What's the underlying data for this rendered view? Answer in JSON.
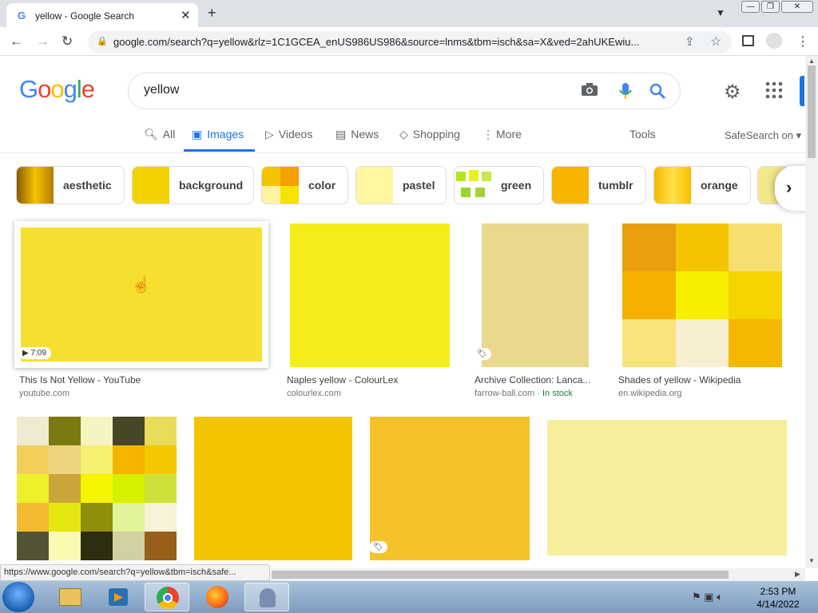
{
  "browser": {
    "tab_title": "yellow - Google Search",
    "tab_favicon": "G",
    "url": "google.com/search?q=yellow&rlz=1C1GCEA_enUS986US986&source=lnms&tbm=isch&sa=X&ved=2ahUKEwiu..."
  },
  "search": {
    "query": "yellow"
  },
  "tabs": [
    {
      "label": "All",
      "icon": "search-icon"
    },
    {
      "label": "Images",
      "icon": "image-icon",
      "active": true
    },
    {
      "label": "Videos",
      "icon": "video-icon"
    },
    {
      "label": "News",
      "icon": "news-icon"
    },
    {
      "label": "Shopping",
      "icon": "tag-icon"
    },
    {
      "label": "More",
      "icon": "more-vert-icon"
    }
  ],
  "tools_label": "Tools",
  "safesearch_label": "SafeSearch on",
  "chips": [
    {
      "label": "aesthetic",
      "color": "#b8860b"
    },
    {
      "label": "background",
      "color": "#f2d200"
    },
    {
      "label": "color",
      "color": "#f5c400"
    },
    {
      "label": "pastel",
      "color": "#fff6a0"
    },
    {
      "label": "green",
      "color": "#c9e84a"
    },
    {
      "label": "tumblr",
      "color": "#f7b500"
    },
    {
      "label": "orange",
      "color": "#f5b800"
    }
  ],
  "results": [
    {
      "title": "This Is Not Yellow - YouTube",
      "source": "youtube.com",
      "badge": "▶ 7:09",
      "color": "#f5e030"
    },
    {
      "title": "Naples yellow - ColourLex",
      "source": "colourlex.com",
      "color": "#f6ec1a"
    },
    {
      "title": "Archive Collection: Lanca...",
      "source": "farrow-ball.com",
      "stock": "In stock",
      "color": "#ead88c"
    },
    {
      "title": "Shades of yellow - Wikipedia",
      "source": "en.wikipedia.org",
      "color": "#f7d000"
    }
  ],
  "row2_colors": [
    "#f5c400",
    "#f5c22c",
    "#f5ef9c"
  ],
  "status_url": "https://www.google.com/search?q=yellow&tbm=isch&safe...",
  "taskbar": {
    "time": "2:53 PM",
    "date": "4/14/2022"
  }
}
